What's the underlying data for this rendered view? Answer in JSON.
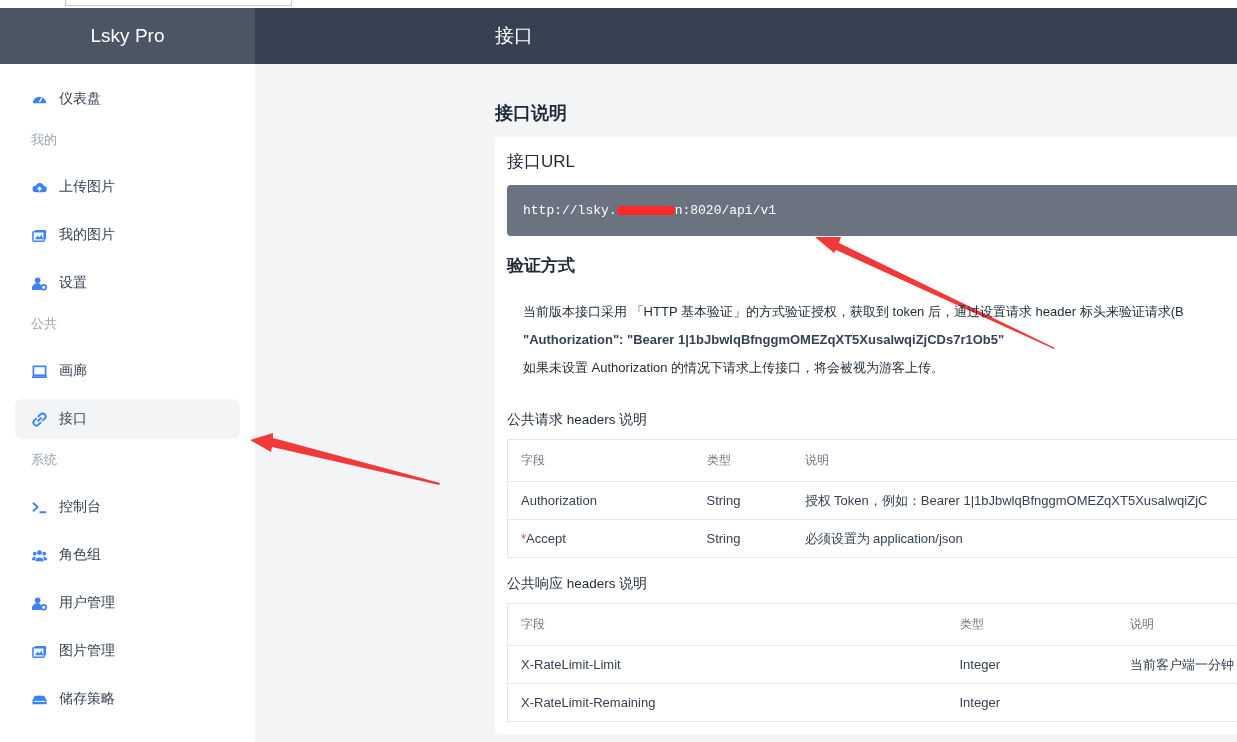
{
  "header": {
    "brand": "Lsky Pro",
    "title": "接口"
  },
  "sidebar": {
    "groups": [
      {
        "items": [
          {
            "label": "仪表盘",
            "selected": false
          }
        ]
      },
      {
        "heading": "我的",
        "items": [
          {
            "label": "上传图片",
            "selected": false
          },
          {
            "label": "我的图片",
            "selected": false
          },
          {
            "label": "设置",
            "selected": false
          }
        ]
      },
      {
        "heading": "公共",
        "items": [
          {
            "label": "画廊",
            "selected": false
          },
          {
            "label": "接口",
            "selected": true
          }
        ]
      },
      {
        "heading": "系统",
        "items": [
          {
            "label": "控制台",
            "selected": false
          },
          {
            "label": "角色组",
            "selected": false
          },
          {
            "label": "用户管理",
            "selected": false
          },
          {
            "label": "图片管理",
            "selected": false
          },
          {
            "label": "储存策略",
            "selected": false
          }
        ]
      }
    ]
  },
  "page_title": "接口说明",
  "url_section": {
    "heading": "接口URL",
    "url_start": "http://lsky.",
    "url_end": "n:8020/api/v1",
    "redacted": true
  },
  "auth_section": {
    "heading": "验证方式",
    "lines": [
      {
        "text": "当前版本接口采用 「HTTP 基本验证」的方式验证授权，获取到 token 后，通过设置请求 header 标头来验证请求(B",
        "bold": false
      },
      {
        "text": "\"Authorization\": \"Bearer 1|1bJbwlqBfnggmOMEZqXT5XusalwqiZjCDs7r1Ob5\"",
        "bold": true
      },
      {
        "text": "如果未设置 Authorization 的情况下请求上传接口，将会被视为游客上传。",
        "bold": false
      }
    ]
  },
  "request_headers": {
    "heading": "公共请求 headers 说明",
    "columns": [
      "字段",
      "类型",
      "说明"
    ],
    "rows": [
      {
        "field": "Authorization",
        "type": "String",
        "description": "授权 Token，例如：Bearer 1|1bJbwlqBfnggmOMEZqXT5XusalwqiZjC"
      },
      {
        "required_mark": "*",
        "field": "Accept",
        "type": "String",
        "description": "必须设置为 application/json"
      }
    ]
  },
  "response_headers": {
    "heading": "公共响应 headers 说明",
    "columns": [
      "字段",
      "类型",
      "说明"
    ],
    "rows": [
      {
        "field": "X-RateLimit-Limit",
        "type": "Integer",
        "description": "当前客户端一分钟"
      },
      {
        "field": "X-RateLimit-Remaining",
        "type": "Integer"
      }
    ]
  }
}
